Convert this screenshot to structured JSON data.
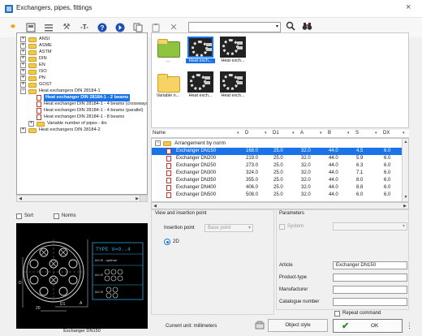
{
  "window": {
    "title": "Exchangers, pipes, fittings",
    "close_glyph": "×"
  },
  "toolbar": {
    "icons": [
      "add-part-icon",
      "panel-icon",
      "list-icon",
      "tools-icon",
      "text-icon",
      "help-icon",
      "next-icon",
      "copy-icon",
      "paste-icon",
      "delete-icon"
    ],
    "search_value": "",
    "search_arrow": "▾"
  },
  "tree": {
    "items": [
      {
        "label": "ANSI",
        "expander": "+"
      },
      {
        "label": "ASME",
        "expander": "+"
      },
      {
        "label": "ASTM",
        "expander": "+"
      },
      {
        "label": "DIN",
        "expander": "+"
      },
      {
        "label": "EN",
        "expander": "+"
      },
      {
        "label": "ISO",
        "expander": "+"
      },
      {
        "label": "PN",
        "expander": "+"
      },
      {
        "label": "GOST",
        "expander": "+"
      },
      {
        "label": "Heat exchangers DIN 28184-1",
        "expander": "−"
      },
      {
        "label": "Heat exchanger DIN 28184-1 - 2 beams",
        "selected": true
      },
      {
        "label": "Heat exchanger DIN 28184-1 - 4 beams (crossways)"
      },
      {
        "label": "Heat exchanger DIN 28184-1 - 4 beams (parallel)"
      },
      {
        "label": "Heat exchanger DIN 28184-1 - 8 beams"
      },
      {
        "label": "Variable number of pipes - ilin",
        "expander": "+"
      },
      {
        "label": "Heat exchangers DIN 28184-2",
        "expander": "+"
      }
    ]
  },
  "thumbnails": [
    {
      "caption": "...",
      "kind": "folder-green"
    },
    {
      "caption": "Heat exch...",
      "kind": "dark",
      "selected": true
    },
    {
      "caption": "Heat exch...",
      "kind": "dark"
    },
    {
      "caption": "Variable n...",
      "kind": "folder"
    },
    {
      "caption": "Heat exch...",
      "kind": "dark"
    },
    {
      "caption": "Heat exch...",
      "kind": "dark"
    }
  ],
  "grid": {
    "columns": [
      "Name",
      "D",
      "D1",
      "A",
      "B",
      "S",
      "DX"
    ],
    "group_label": "Arrangement by norm",
    "rows": [
      {
        "name": "Exchanger DN150",
        "D": "168.0",
        "D1": "25.0",
        "A": "32.0",
        "B": "44.0",
        "S": "4.5",
        "DX": "6.0",
        "selected": true
      },
      {
        "name": "Exchanger DN200",
        "D": "219.0",
        "D1": "25.0",
        "A": "32.0",
        "B": "44.0",
        "S": "5.9",
        "DX": "6.0"
      },
      {
        "name": "Exchanger DN250",
        "D": "273.0",
        "D1": "25.0",
        "A": "32.0",
        "B": "44.0",
        "S": "6.3",
        "DX": "6.0"
      },
      {
        "name": "Exchanger DN300",
        "D": "324.0",
        "D1": "25.0",
        "A": "32.0",
        "B": "44.0",
        "S": "7.1",
        "DX": "6.0"
      },
      {
        "name": "Exchanger DN350",
        "D": "355.0",
        "D1": "25.0",
        "A": "32.0",
        "B": "44.0",
        "S": "8.0",
        "DX": "6.0"
      },
      {
        "name": "Exchanger DN400",
        "D": "406.0",
        "D1": "25.0",
        "A": "32.0",
        "B": "44.0",
        "S": "8.8",
        "DX": "6.0"
      },
      {
        "name": "Exchanger DN500",
        "D": "508.0",
        "D1": "25.0",
        "A": "32.0",
        "B": "44.0",
        "S": "6.0",
        "DX": "6.0"
      }
    ]
  },
  "options": {
    "sort_label": "Sort",
    "norms_label": "Norms",
    "sort_checked": false,
    "norms_checked": false
  },
  "preview": {
    "caption": "Exchanger DN150",
    "type_label": "TYPE  V=0..4",
    "side_text_1": "&V<E - optimal",
    "side_text_2": "&V<E",
    "side_text_3": "&V<E",
    "dim_a": "A",
    "dim_d": "D",
    "dim_d1": "D1",
    "dim_20": "20"
  },
  "view_insertion": {
    "heading": "View and insertion point",
    "insertion_label": "Insertion point",
    "insertion_value": "Base point",
    "mode_label": "2D"
  },
  "parameters": {
    "heading": "Parameters",
    "system_label": "System",
    "system_value": "",
    "article_label": "Article",
    "article_value": "Exchanger DN150",
    "product_type_label": "Product-type",
    "product_type_value": "",
    "manufacturer_label": "Manufacturer",
    "manufacturer_value": "",
    "catalogue_label": "Catalogue number",
    "catalogue_value": ""
  },
  "footer": {
    "unit_text": "Current unit: millimeters",
    "object_style_label": "Object style",
    "repeat_label": "Repeat command",
    "ok_label": "OK",
    "more_glyph": "⋮"
  },
  "colors": {
    "accent": "#1a73e8",
    "toolbar_yellow": "#e0a800",
    "help_blue": "#1e4fb5",
    "folder": "#f2c94c",
    "doc_red": "#c0392b",
    "ok_check": "#2e8b2e"
  }
}
